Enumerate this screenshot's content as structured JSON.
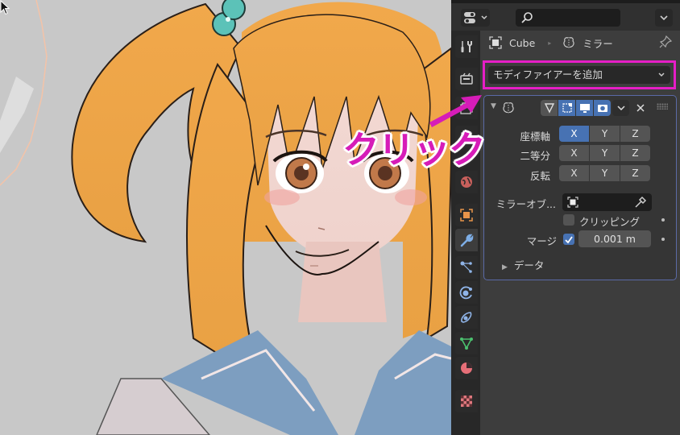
{
  "viewport": {
    "description": "3D viewport showing an anime-style illustration of a girl with orange hair and teal hair ties wearing a sailor uniform"
  },
  "header": {
    "editor_type_icon": "properties-editor-icon",
    "search_placeholder": "",
    "search_icon": "search-icon",
    "options_icon": "chevron-down-icon"
  },
  "tabs": [
    {
      "name": "tool",
      "icon": "tool-icon"
    },
    {
      "name": "render",
      "icon": "render-icon"
    },
    {
      "name": "output",
      "icon": "output-icon"
    },
    {
      "name": "view-layer",
      "icon": "view-layer-icon"
    },
    {
      "name": "world",
      "icon": "world-icon"
    },
    {
      "name": "object",
      "icon": "object-icon"
    },
    {
      "name": "modifiers",
      "icon": "wrench-icon",
      "active": true
    },
    {
      "name": "particles",
      "icon": "particles-icon"
    },
    {
      "name": "physics",
      "icon": "physics-icon"
    },
    {
      "name": "constraints",
      "icon": "constraints-icon"
    },
    {
      "name": "data",
      "icon": "mesh-data-icon"
    },
    {
      "name": "material",
      "icon": "material-icon"
    },
    {
      "name": "texture",
      "icon": "texture-icon"
    }
  ],
  "breadcrumb": {
    "object_name": "Cube",
    "modifier_name": "ミラー"
  },
  "add_modifier": {
    "label": "モディファイアーを追加"
  },
  "modifier": {
    "rows": {
      "axis": {
        "label": "座標軸",
        "options": [
          "X",
          "Y",
          "Z"
        ],
        "active": [
          "X"
        ]
      },
      "bisect": {
        "label": "二等分",
        "options": [
          "X",
          "Y",
          "Z"
        ],
        "active": []
      },
      "flip": {
        "label": "反転",
        "options": [
          "X",
          "Y",
          "Z"
        ],
        "active": []
      }
    },
    "mirror_object": {
      "label": "ミラーオブ...",
      "value": ""
    },
    "clipping": {
      "label": "クリッピング",
      "checked": false
    },
    "merge": {
      "label": "マージ",
      "checked": true,
      "value": "0.001 m"
    },
    "data_subpanel": {
      "label": "データ",
      "expanded": false
    }
  },
  "annotation": {
    "text": "クリック",
    "color": "#d61cb8",
    "highlight_color": "#e61ec6"
  },
  "colors": {
    "accent_blue": "#4772b3",
    "panel_border": "#5a6aa6"
  }
}
